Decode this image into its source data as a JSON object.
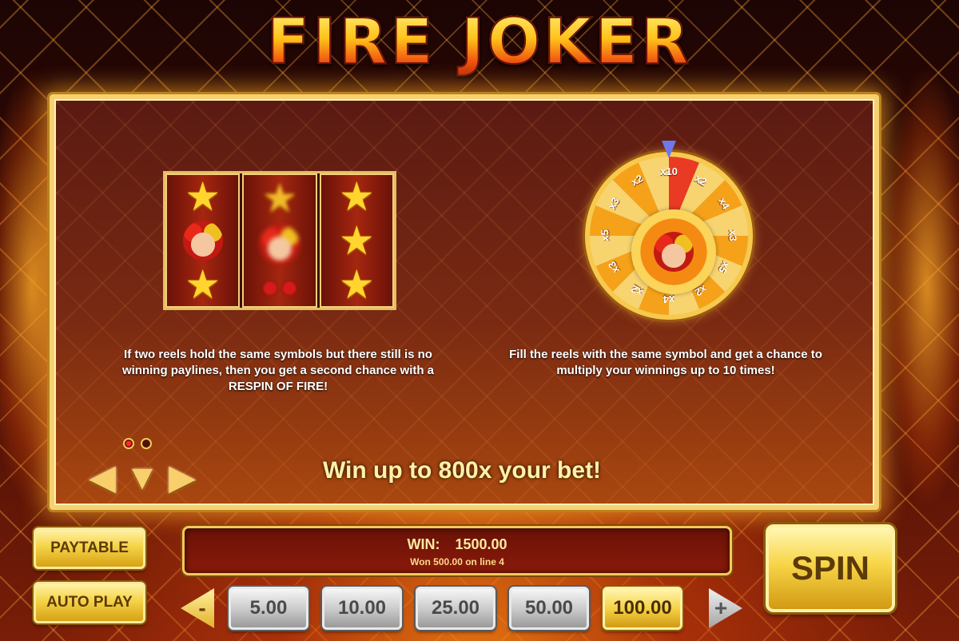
{
  "game": {
    "title": "FIRE JOKER"
  },
  "info": {
    "left_text": "If two reels hold the same symbols but there still is no winning paylines, then you get a second chance with a RESPIN OF FIRE!",
    "right_text": "Fill the reels with the same symbol and get a chance to multiply your winnings up to 10 times!",
    "headline": "Win up to 800x your bet!"
  },
  "wheel": {
    "segments": [
      "x10",
      "x2",
      "x4",
      "x3",
      "x5",
      "x2",
      "x4",
      "x2",
      "x3",
      "x5",
      "x3",
      "x2"
    ]
  },
  "pagination": {
    "pages": 2,
    "active_index": 0
  },
  "navigation": {
    "prev_icon": "left-arrow-icon",
    "down_icon": "down-arrow-icon",
    "next_icon": "right-arrow-icon"
  },
  "controls": {
    "paytable_label": "PAYTABLE",
    "autoplay_label": "AUTO PLAY",
    "spin_label": "SPIN",
    "win_label": "WIN:",
    "win_value": "1500.00",
    "win_detail": "Won 500.00 on line 4",
    "minus_label": "-",
    "plus_label": "+",
    "bets": [
      {
        "label": "5.00",
        "selected": false
      },
      {
        "label": "10.00",
        "selected": false
      },
      {
        "label": "25.00",
        "selected": false
      },
      {
        "label": "50.00",
        "selected": false
      },
      {
        "label": "100.00",
        "selected": true
      }
    ]
  },
  "colors": {
    "gold": "#f7d170",
    "panel_red": "#7a2a12",
    "win_text": "#ffeaa0"
  }
}
